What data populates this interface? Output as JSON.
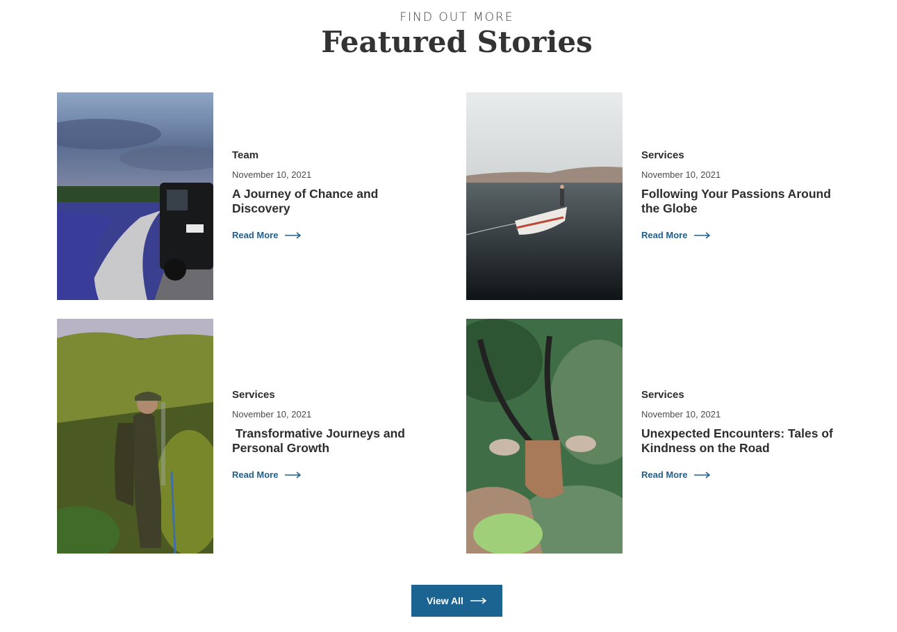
{
  "section": {
    "eyebrow": "FIND OUT MORE",
    "title": "Featured Stories"
  },
  "stories": [
    {
      "category": "Team",
      "date": "November 10, 2021",
      "title": "A Journey of Chance and Discovery",
      "link_label": "Read More"
    },
    {
      "category": "Services",
      "date": "November 10, 2021",
      "title": "Following Your Passions Around the Globe",
      "link_label": "Read More"
    },
    {
      "category": "Services",
      "date": "November 10, 2021",
      "title": " Transformative Journeys and Personal Growth",
      "link_label": "Read More"
    },
    {
      "category": "Services",
      "date": "November 10, 2021",
      "title": "Unexpected Encounters: Tales of Kindness on the Road",
      "link_label": "Read More"
    }
  ],
  "footer": {
    "view_all_label": "View All"
  },
  "colors": {
    "accent": "#1b6391",
    "link": "#1f5f8b",
    "heading": "#333333"
  }
}
